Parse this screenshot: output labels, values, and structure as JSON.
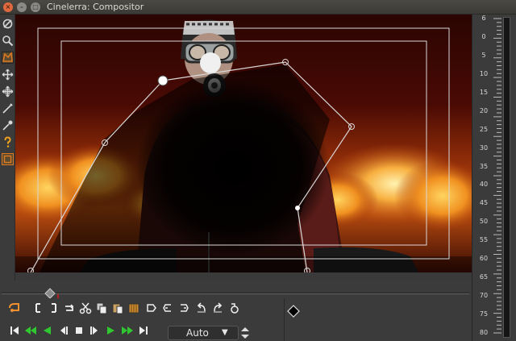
{
  "window": {
    "title": "Cinelerra: Compositor",
    "close_glyph": "×",
    "min_glyph": "–",
    "max_glyph": "□"
  },
  "left_tools": [
    {
      "name": "protect-icon"
    },
    {
      "name": "zoom-icon"
    },
    {
      "name": "mask-icon",
      "active": true
    },
    {
      "name": "camera-move-icon"
    },
    {
      "name": "projector-move-icon"
    },
    {
      "name": "crop-icon"
    },
    {
      "name": "eyedropper-icon"
    },
    {
      "name": "help-icon"
    },
    {
      "name": "safe-region-icon"
    }
  ],
  "meter": {
    "labels": [
      "6",
      "0",
      "5",
      "10",
      "15",
      "20",
      "25",
      "30",
      "35",
      "40",
      "45",
      "50",
      "55",
      "60",
      "65",
      "70",
      "75",
      "80"
    ]
  },
  "transport": {
    "zoom_mode": "Auto"
  },
  "colors": {
    "accent_green": "#30c830",
    "mask_line": "#d0d0d0",
    "panel": "#3b3b3b"
  }
}
